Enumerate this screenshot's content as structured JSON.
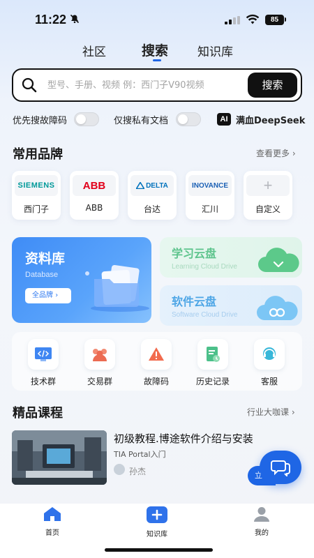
{
  "status_bar": {
    "time": "11:22",
    "battery": "85"
  },
  "top_tabs": [
    "社区",
    "搜索",
    "知识库"
  ],
  "search": {
    "placeholder": "型号、手册、视频 例：西门子V90视频",
    "button": "搜索"
  },
  "options": {
    "fault_code_first": "优先搜故障码",
    "private_docs_only": "仅搜私有文档",
    "ai_badge": "AI",
    "deepseek": "满血DeepSeek"
  },
  "brands": {
    "title": "常用品牌",
    "more": "查看更多",
    "items": [
      {
        "logo": "SIEMENS",
        "name": "西门子",
        "color": "#009999"
      },
      {
        "logo": "ABB",
        "name": "ABB",
        "color": "#e2001a"
      },
      {
        "logo": "DELTA",
        "name": "台达",
        "color": "#0072bc"
      },
      {
        "logo": "INOVANCE",
        "name": "汇川",
        "color": "#1a5fb4"
      },
      {
        "logo": "+",
        "name": "自定义",
        "color": "#b5b8bd"
      }
    ]
  },
  "database_card": {
    "title": "资料库",
    "subtitle": "Database",
    "button": "全品牌"
  },
  "learning_cloud": {
    "title": "学习云盘",
    "subtitle": "Learning Cloud Drive"
  },
  "software_cloud": {
    "title": "软件云盘",
    "subtitle": "Software Cloud Drive"
  },
  "tools": [
    "技术群",
    "交易群",
    "故障码",
    "历史记录",
    "客服"
  ],
  "courses": {
    "title": "精品课程",
    "more": "行业大咖课",
    "item": {
      "title": "初级教程.博途软件介绍与安装",
      "subtitle": "TIA Portal入门",
      "author": "孙杰"
    }
  },
  "floating_chip": "立",
  "bottom_nav": [
    "首页",
    "知识库",
    "我的"
  ]
}
